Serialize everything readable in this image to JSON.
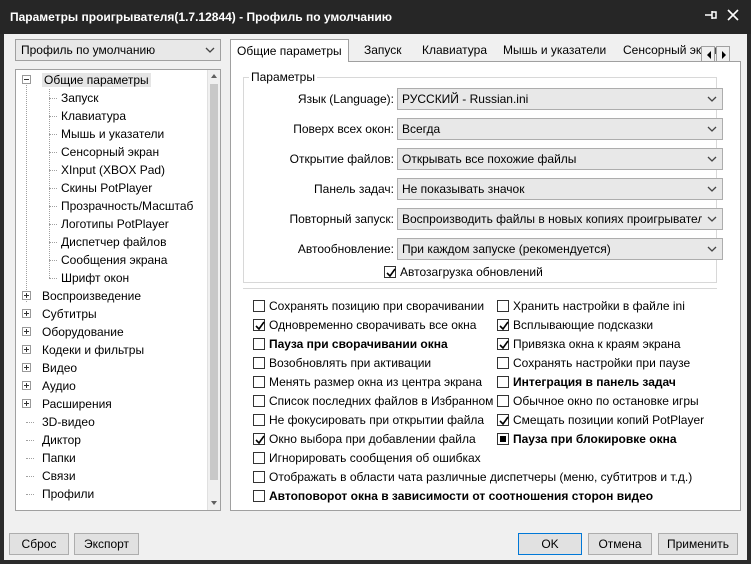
{
  "window": {
    "title": "Параметры проигрывателя(1.7.12844) - Профиль по умолчанию",
    "pin_icon": "pin-icon",
    "close_icon": "close-icon"
  },
  "profile_select": {
    "value": "Профиль по умолчанию"
  },
  "tree": {
    "items": [
      {
        "label": "Общие параметры",
        "level": 0,
        "expander": "minus",
        "selected": true
      },
      {
        "label": "Запуск",
        "level": 1
      },
      {
        "label": "Клавиатура",
        "level": 1
      },
      {
        "label": "Мышь и указатели",
        "level": 1
      },
      {
        "label": "Сенсорный экран",
        "level": 1
      },
      {
        "label": "XInput (XBOX Pad)",
        "level": 1
      },
      {
        "label": "Скины PotPlayer",
        "level": 1
      },
      {
        "label": "Прозрачность/Масштаб",
        "level": 1
      },
      {
        "label": "Логотипы PotPlayer",
        "level": 1
      },
      {
        "label": "Диспетчер файлов",
        "level": 1
      },
      {
        "label": "Сообщения экрана",
        "level": 1
      },
      {
        "label": "Шрифт окон",
        "level": 1
      },
      {
        "label": "Воспроизведение",
        "level": 0,
        "expander": "plus"
      },
      {
        "label": "Субтитры",
        "level": 0,
        "expander": "plus"
      },
      {
        "label": "Оборудование",
        "level": 0,
        "expander": "plus"
      },
      {
        "label": "Кодеки и фильтры",
        "level": 0,
        "expander": "plus"
      },
      {
        "label": "Видео",
        "level": 0,
        "expander": "plus"
      },
      {
        "label": "Аудио",
        "level": 0,
        "expander": "plus"
      },
      {
        "label": "Расширения",
        "level": 0,
        "expander": "plus"
      },
      {
        "label": "3D-видео",
        "level": 0
      },
      {
        "label": "Диктор",
        "level": 0
      },
      {
        "label": "Папки",
        "level": 0
      },
      {
        "label": "Связи",
        "level": 0
      },
      {
        "label": "Профили",
        "level": 0
      }
    ]
  },
  "tabs": [
    {
      "label": "Общие параметры",
      "active": true
    },
    {
      "label": "Запуск"
    },
    {
      "label": "Клавиатура"
    },
    {
      "label": "Мышь и указатели"
    },
    {
      "label": "Сенсорный экран"
    }
  ],
  "group": {
    "legend": "Параметры",
    "rows": [
      {
        "label": "Язык (Language):",
        "value": "РУССКИЙ - Russian.ini"
      },
      {
        "label": "Поверх всех окон:",
        "value": "Всегда"
      },
      {
        "label": "Открытие файлов:",
        "value": "Открывать все похожие файлы"
      },
      {
        "label": "Панель задач:",
        "value": "Не показывать значок"
      },
      {
        "label": "Повторный запуск:",
        "value": "Воспроизводить файлы в новых копиях проигрывателя"
      },
      {
        "label": "Автообновление:",
        "value": "При каждом запуске (рекомендуется)"
      }
    ],
    "autoload": {
      "label": "Автозагрузка обновлений",
      "checked": true
    }
  },
  "options_left": [
    {
      "label": "Сохранять позицию при сворачивании",
      "checked": false
    },
    {
      "label": "Одновременно сворачивать все окна",
      "checked": true
    },
    {
      "label": "Пауза при сворачивании окна",
      "checked": false,
      "bold": true
    },
    {
      "label": "Возобновлять при активации",
      "checked": false
    },
    {
      "label": "Менять размер окна из центра экрана",
      "checked": false
    },
    {
      "label": "Список последних файлов в Избранном",
      "checked": false
    },
    {
      "label": "Не фокусировать при открытии файла",
      "checked": false
    },
    {
      "label": "Окно выбора при добавлении файла",
      "checked": true
    },
    {
      "label": "Игнорировать сообщения об ошибках",
      "checked": false
    }
  ],
  "options_right": [
    {
      "label": "Хранить настройки в файле ini",
      "checked": false
    },
    {
      "label": "Всплывающие подсказки",
      "checked": true
    },
    {
      "label": "Привязка окна к краям экрана",
      "checked": true
    },
    {
      "label": "Сохранять настройки при паузе",
      "checked": false
    },
    {
      "label": "Интеграция в панель задач",
      "checked": false,
      "bold": true
    },
    {
      "label": "Обычное окно по остановке игры",
      "checked": false
    },
    {
      "label": "Смещать позиции копий PotPlayer",
      "checked": true
    },
    {
      "label": "Пауза при блокировке окна",
      "checked": false,
      "bold": true,
      "state": "indeterminate"
    }
  ],
  "options_wide": [
    {
      "label": "Отображать в области чата различные диспетчеры (меню, субтитров и т.д.)",
      "checked": false
    },
    {
      "label": "Автоповорот окна в зависимости от соотношения сторон видео",
      "checked": false,
      "bold": true
    }
  ],
  "buttons": {
    "reset": "Сброс",
    "export": "Экспорт",
    "ok": "OK",
    "cancel": "Отмена",
    "apply": "Применить"
  }
}
